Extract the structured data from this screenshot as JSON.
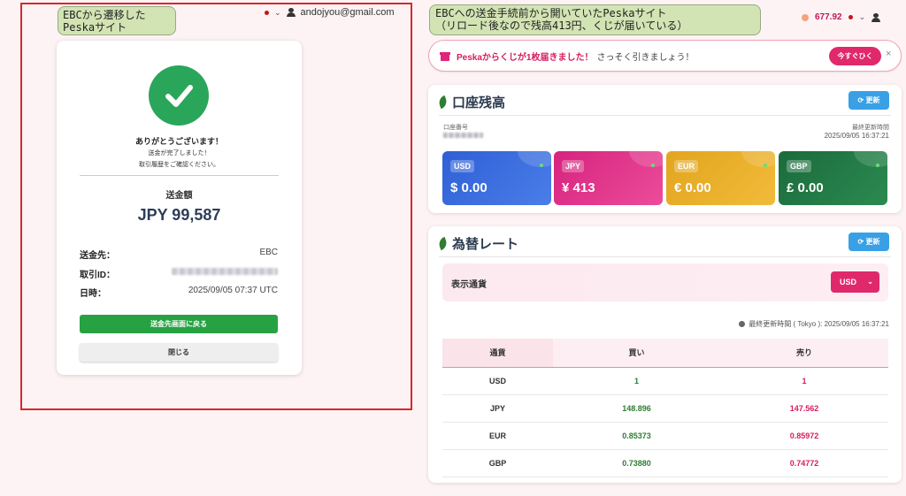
{
  "annotations": {
    "left_note": [
      "EBCから遷移した",
      "Peskaサイト"
    ],
    "right_note": [
      "EBCへの送金手続前から開いていたPeskaサイト",
      "（リロード後なので残高413円、くじが届いている）"
    ]
  },
  "left": {
    "user_email": "andojyou@gmail.com",
    "thanks": "ありがとうございます！",
    "sub1": "送金が完了しました！",
    "sub2": "取引履歴をご確認ください。",
    "amount_label": "送金額",
    "amount": "JPY 99,587",
    "rows": [
      {
        "key": "送金先：",
        "value": "EBC"
      },
      {
        "key": "取引ID：",
        "value": ""
      },
      {
        "key": "日時：",
        "value": "2025/09/05 07:37 UTC"
      }
    ],
    "back_button": "送金先画面に戻る",
    "close_button": "閉じる"
  },
  "right": {
    "header_balance": "677.92",
    "lottery": {
      "msg_a": "Peskaからくじが1枚届きました！",
      "msg_b": "さっそく引きましょう！",
      "button": "今すぐひく",
      "close": "×"
    },
    "balance_panel": {
      "title": "口座残高",
      "refresh": "更新",
      "account_label": "口座番号",
      "updated_label": "最終更新時間",
      "updated_value": "2025/09/05 16:37:21",
      "currencies": [
        {
          "code": "USD",
          "value": "$ 0.00"
        },
        {
          "code": "JPY",
          "value": "¥ 413"
        },
        {
          "code": "EUR",
          "value": "€ 0.00"
        },
        {
          "code": "GBP",
          "value": "£ 0.00"
        }
      ]
    },
    "rate_panel": {
      "title": "為替レート",
      "refresh": "更新",
      "display_label": "表示通貨",
      "display_value": "USD",
      "updated": "最終更新時間 ( Tokyo ): 2025/09/05 16:37:21",
      "columns": [
        "通貨",
        "買い",
        "売り"
      ],
      "rows": [
        {
          "currency": "USD",
          "buy": "1",
          "sell": "1"
        },
        {
          "currency": "JPY",
          "buy": "148.896",
          "sell": "147.562"
        },
        {
          "currency": "EUR",
          "buy": "0.85373",
          "sell": "0.85972"
        },
        {
          "currency": "GBP",
          "buy": "0.73880",
          "sell": "0.74772"
        }
      ]
    }
  }
}
